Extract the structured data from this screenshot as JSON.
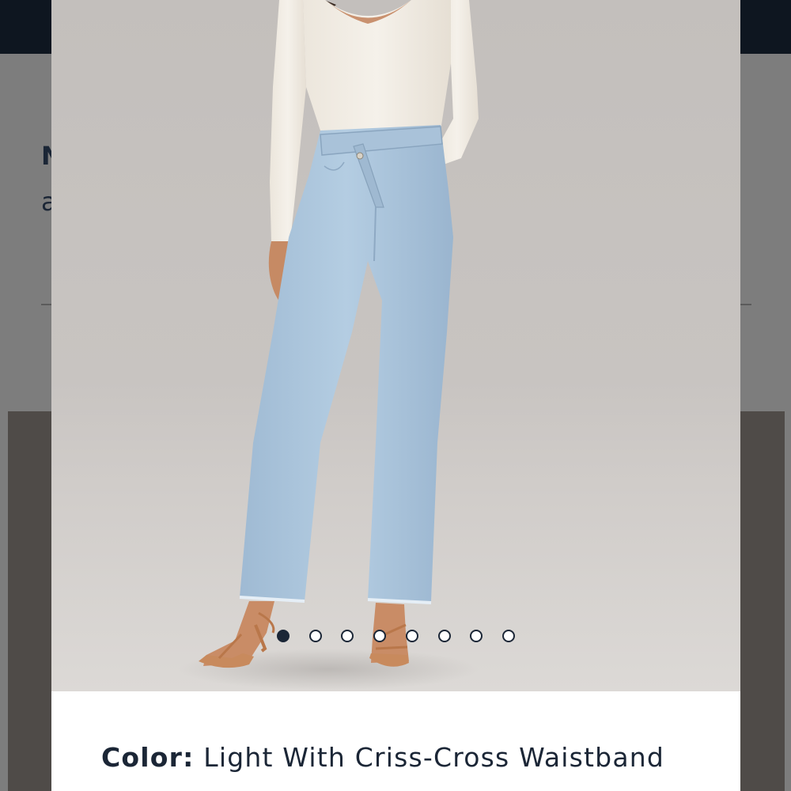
{
  "background_page": {
    "heading_partial": "N",
    "subheading_partial": "a"
  },
  "product_modal": {
    "gallery": {
      "image_alt": "Model wearing light wash straight jeans with criss-cross waistband, cream ribbed top and tan strappy heels",
      "total_images": 8,
      "active_index": 1
    },
    "color_label": "Color:",
    "color_value": "Light With Criss-Cross Waistband"
  },
  "colors": {
    "brand_navy": "#1b2636",
    "top_bar": "#0e1620",
    "denim": "#a9c4dc",
    "backdrop": "#c6c2bf"
  }
}
